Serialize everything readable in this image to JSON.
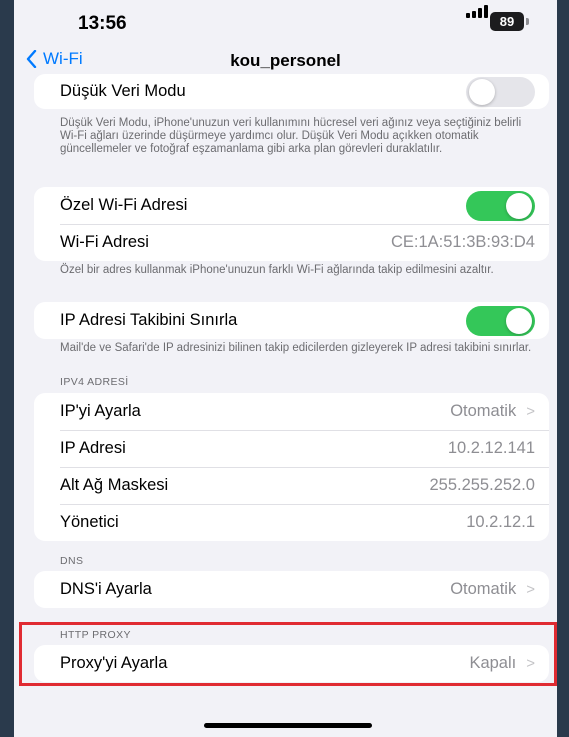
{
  "status_bar": {
    "time": "13:56",
    "battery": "89"
  },
  "nav": {
    "back_label": "Wi-Fi",
    "title": "kou_personel"
  },
  "low_data": {
    "label": "Düşük Veri Modu",
    "enabled": false,
    "footer": "Düşük Veri Modu, iPhone'unuzun veri kullanımını hücresel veri ağınız veya seçtiğiniz belirli Wi-Fi ağları üzerinde düşürmeye yardımcı olur. Düşük Veri Modu açıkken otomatik güncellemeler ve fotoğraf eşzamanlama gibi arka plan görevleri duraklatılır."
  },
  "private_address": {
    "label": "Özel Wi-Fi Adresi",
    "enabled": true,
    "address_label": "Wi-Fi Adresi",
    "address_value": "CE:1A:51:3B:93:D4",
    "footer": "Özel bir adres kullanmak iPhone'unuzun farklı Wi-Fi ağlarında takip edilmesini azaltır."
  },
  "ip_tracking": {
    "label": "IP Adresi Takibini Sınırla",
    "enabled": true,
    "footer": "Mail'de ve Safari'de IP adresinizi bilinen takip edicilerden gizleyerek IP adresi takibini sınırlar."
  },
  "ipv4": {
    "header": "IPV4 ADRESİ",
    "configure_label": "IP'yi Ayarla",
    "configure_value": "Otomatik",
    "ip_label": "IP Adresi",
    "ip_value": "10.2.12.141",
    "subnet_label": "Alt Ağ Maskesi",
    "subnet_value": "255.255.252.0",
    "router_label": "Yönetici",
    "router_value": "10.2.12.1"
  },
  "dns": {
    "header": "DNS",
    "configure_label": "DNS'i Ayarla",
    "configure_value": "Otomatik"
  },
  "proxy": {
    "header": "HTTP PROXY",
    "configure_label": "Proxy'yi Ayarla",
    "configure_value": "Kapalı"
  },
  "colors": {
    "accent": "#007aff",
    "toggle_on": "#34c759",
    "highlight": "#e02b32"
  },
  "icons": {
    "back": "chevron-left-icon",
    "disclosure": "chevron-right-icon",
    "signal": "signal-bars-icon",
    "battery": "battery-icon"
  }
}
